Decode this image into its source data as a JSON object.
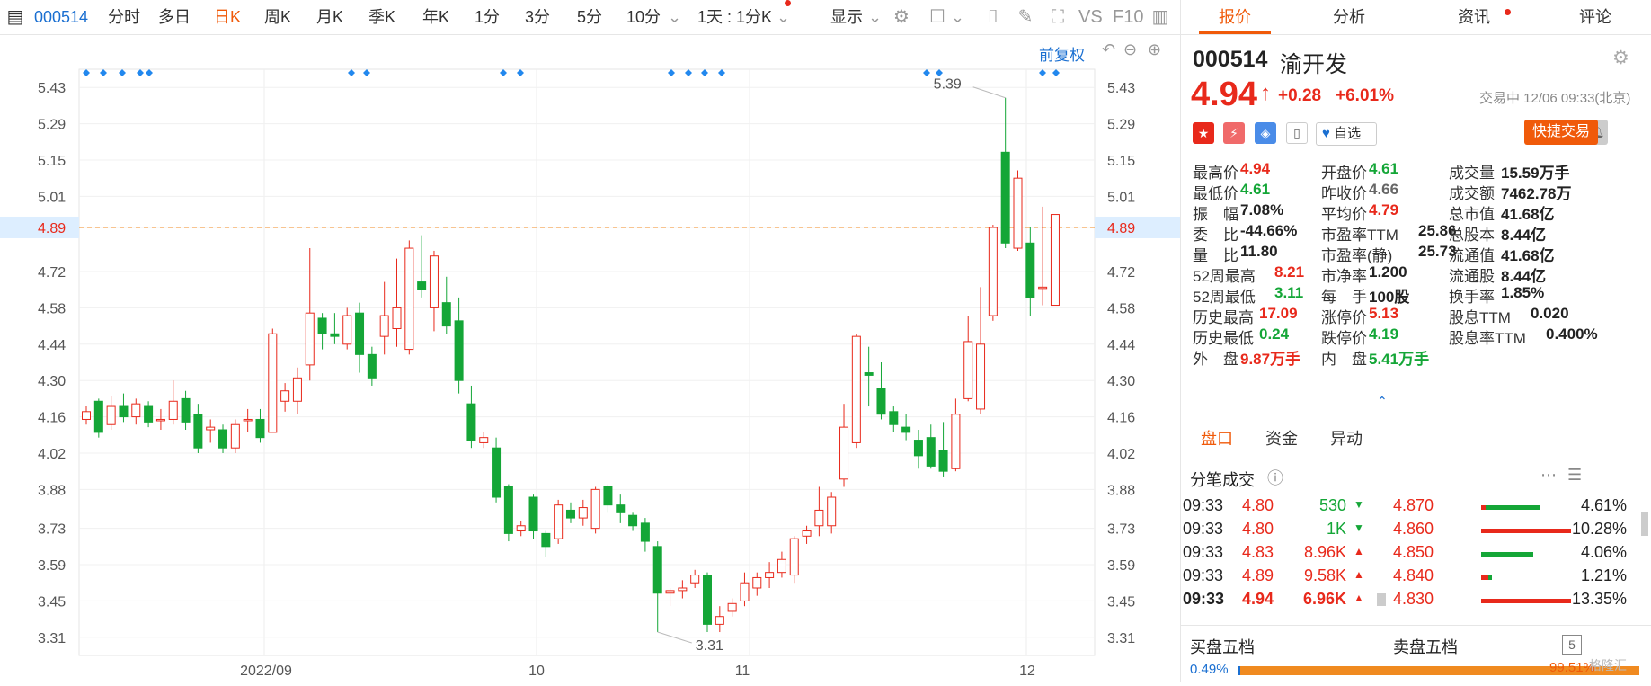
{
  "toolbar": {
    "code": "000514",
    "items": [
      "分时",
      "多日",
      "日K",
      "周K",
      "月K",
      "季K",
      "年K",
      "1分",
      "3分",
      "5分",
      "10分",
      "1天 : 1分K",
      "显示",
      "VS",
      "F10"
    ],
    "active": "日K",
    "restore_label": "前复权"
  },
  "chart": {
    "price_labels": [
      "5.43",
      "5.29",
      "5.15",
      "5.01",
      "4.89",
      "4.72",
      "4.58",
      "4.44",
      "4.30",
      "4.16",
      "4.02",
      "3.88",
      "3.73",
      "3.59",
      "3.45",
      "3.31"
    ],
    "current_price_label": "4.89",
    "date_labels": [
      "2022/09",
      "10",
      "11",
      "12"
    ],
    "high_annotation": "5.39",
    "low_annotation": "3.31"
  },
  "chart_data": {
    "type": "candlestick",
    "y_range": [
      3.24,
      5.5
    ],
    "x_labels": [
      "2022/09",
      "10",
      "11",
      "12"
    ],
    "current_price": 4.89,
    "max_label": "5.39",
    "min_label": "3.31",
    "candles": [
      [
        4.15,
        4.18,
        4.13,
        4.2
      ],
      [
        4.22,
        4.1,
        4.08,
        4.23
      ],
      [
        4.13,
        4.2,
        4.11,
        4.24
      ],
      [
        4.2,
        4.16,
        4.14,
        4.25
      ],
      [
        4.16,
        4.21,
        4.13,
        4.23
      ],
      [
        4.2,
        4.14,
        4.12,
        4.22
      ],
      [
        4.15,
        4.15,
        4.11,
        4.19
      ],
      [
        4.15,
        4.22,
        4.13,
        4.3
      ],
      [
        4.23,
        4.14,
        4.11,
        4.26
      ],
      [
        4.17,
        4.04,
        4.02,
        4.21
      ],
      [
        4.11,
        4.12,
        4.06,
        4.15
      ],
      [
        4.11,
        4.04,
        4.02,
        4.13
      ],
      [
        4.04,
        4.13,
        4.02,
        4.15
      ],
      [
        4.15,
        4.15,
        4.1,
        4.19
      ],
      [
        4.15,
        4.08,
        4.06,
        4.19
      ],
      [
        4.1,
        4.48,
        4.1,
        4.5
      ],
      [
        4.22,
        4.26,
        4.18,
        4.29
      ],
      [
        4.22,
        4.31,
        4.17,
        4.35
      ],
      [
        4.36,
        4.56,
        4.3,
        4.81
      ],
      [
        4.54,
        4.48,
        4.42,
        4.56
      ],
      [
        4.48,
        4.47,
        4.44,
        4.56
      ],
      [
        4.44,
        4.55,
        4.42,
        4.58
      ],
      [
        4.56,
        4.4,
        4.33,
        4.6
      ],
      [
        4.4,
        4.31,
        4.28,
        4.43
      ],
      [
        4.47,
        4.55,
        4.4,
        4.68
      ],
      [
        4.5,
        4.58,
        4.43,
        4.77
      ],
      [
        4.42,
        4.81,
        4.4,
        4.84
      ],
      [
        4.68,
        4.65,
        4.62,
        4.86
      ],
      [
        4.58,
        4.78,
        4.49,
        4.8
      ],
      [
        4.6,
        4.51,
        4.48,
        4.7
      ],
      [
        4.53,
        4.3,
        4.25,
        4.62
      ],
      [
        4.21,
        4.07,
        4.04,
        4.28
      ],
      [
        4.06,
        4.08,
        4.04,
        4.1
      ],
      [
        4.04,
        3.85,
        3.83,
        4.08
      ],
      [
        3.89,
        3.71,
        3.68,
        3.9
      ],
      [
        3.72,
        3.74,
        3.7,
        3.76
      ],
      [
        3.85,
        3.72,
        3.69,
        3.86
      ],
      [
        3.71,
        3.66,
        3.62,
        3.72
      ],
      [
        3.69,
        3.82,
        3.67,
        3.84
      ],
      [
        3.8,
        3.77,
        3.75,
        3.83
      ],
      [
        3.77,
        3.81,
        3.74,
        3.84
      ],
      [
        3.73,
        3.88,
        3.71,
        3.89
      ],
      [
        3.89,
        3.82,
        3.79,
        3.9
      ],
      [
        3.82,
        3.79,
        3.75,
        3.86
      ],
      [
        3.78,
        3.74,
        3.72,
        3.79
      ],
      [
        3.75,
        3.68,
        3.64,
        3.77
      ],
      [
        3.66,
        3.48,
        3.33,
        3.68
      ],
      [
        3.48,
        3.49,
        3.43,
        3.5
      ],
      [
        3.49,
        3.5,
        3.46,
        3.53
      ],
      [
        3.52,
        3.55,
        3.5,
        3.57
      ],
      [
        3.55,
        3.36,
        3.33,
        3.56
      ],
      [
        3.36,
        3.39,
        3.33,
        3.43
      ],
      [
        3.41,
        3.44,
        3.39,
        3.46
      ],
      [
        3.45,
        3.52,
        3.43,
        3.56
      ],
      [
        3.5,
        3.54,
        3.47,
        3.56
      ],
      [
        3.54,
        3.56,
        3.5,
        3.6
      ],
      [
        3.56,
        3.61,
        3.54,
        3.64
      ],
      [
        3.55,
        3.69,
        3.52,
        3.7
      ],
      [
        3.7,
        3.72,
        3.67,
        3.74
      ],
      [
        3.74,
        3.8,
        3.7,
        3.89
      ],
      [
        3.74,
        3.85,
        3.71,
        3.87
      ],
      [
        3.92,
        4.12,
        3.89,
        4.21
      ],
      [
        4.06,
        4.47,
        4.04,
        4.48
      ],
      [
        4.33,
        4.32,
        4.2,
        4.43
      ],
      [
        4.27,
        4.17,
        4.15,
        4.37
      ],
      [
        4.18,
        4.13,
        4.1,
        4.2
      ],
      [
        4.12,
        4.1,
        4.07,
        4.17
      ],
      [
        4.07,
        4.01,
        3.96,
        4.11
      ],
      [
        4.08,
        3.97,
        3.96,
        4.13
      ],
      [
        4.03,
        3.95,
        3.93,
        4.14
      ],
      [
        3.96,
        4.17,
        3.95,
        4.23
      ],
      [
        4.23,
        4.45,
        4.22,
        4.55
      ],
      [
        4.19,
        4.44,
        4.17,
        4.66
      ],
      [
        4.55,
        4.89,
        4.53,
        4.9
      ],
      [
        5.18,
        4.83,
        4.81,
        5.39
      ],
      [
        4.81,
        5.08,
        4.8,
        5.11
      ],
      [
        4.83,
        4.62,
        4.55,
        4.89
      ],
      [
        4.66,
        4.66,
        4.59,
        4.97
      ],
      [
        4.59,
        4.94,
        4.59,
        4.94
      ]
    ]
  },
  "quote": {
    "code": "000514",
    "name": "渝开发",
    "price": "4.94",
    "change": "+0.28",
    "change_pct": "+6.01%",
    "status_time": "交易中 12/06 09:33(北京)",
    "watch_label": "自选",
    "trade_button": "快捷交易"
  },
  "tabs": [
    "报价",
    "分析",
    "资讯",
    "评论"
  ],
  "stats": [
    [
      {
        "label": "最高价",
        "value": "4.94",
        "color": "red"
      },
      {
        "label": "开盘价",
        "value": "4.61",
        "color": "green"
      },
      {
        "label": "成交量",
        "value": "15.59万手",
        "color": "black"
      }
    ],
    [
      {
        "label": "最低价",
        "value": "4.61",
        "color": "green"
      },
      {
        "label": "昨收价",
        "value": "4.66",
        "color": "gray"
      },
      {
        "label": "成交额",
        "value": "7462.78万",
        "color": "black"
      }
    ],
    [
      {
        "label": "振　幅",
        "value": "7.08%",
        "color": "black"
      },
      {
        "label": "平均价",
        "value": "4.79",
        "color": "red"
      },
      {
        "label": "总市值",
        "value": "41.68亿",
        "color": "black"
      }
    ],
    [
      {
        "label": "委　比",
        "value": "-44.66%",
        "color": "black"
      },
      {
        "label": "市盈率TTM",
        "value": "25.86",
        "color": "black"
      },
      {
        "label": "总股本",
        "value": "8.44亿",
        "color": "black"
      }
    ],
    [
      {
        "label": "量　比",
        "value": "11.80",
        "color": "black"
      },
      {
        "label": "市盈率(静)",
        "value": "25.73",
        "color": "black"
      },
      {
        "label": "流通值",
        "value": "41.68亿",
        "color": "black"
      }
    ],
    [
      {
        "label": "52周最高",
        "value": "8.21",
        "color": "red"
      },
      {
        "label": "市净率",
        "value": "1.200",
        "color": "black"
      },
      {
        "label": "流通股",
        "value": "8.44亿",
        "color": "black"
      }
    ],
    [
      {
        "label": "52周最低",
        "value": "3.11",
        "color": "green"
      },
      {
        "label": "每　手",
        "value": "100股",
        "color": "black"
      },
      {
        "label": "换手率",
        "value": "1.85%",
        "color": "black"
      }
    ],
    [
      {
        "label": "历史最高",
        "value": "17.09",
        "color": "red"
      },
      {
        "label": "涨停价",
        "value": "5.13",
        "color": "red"
      },
      {
        "label": "股息TTM",
        "value": "0.020",
        "color": "black"
      }
    ],
    [
      {
        "label": "历史最低",
        "value": "0.24",
        "color": "green"
      },
      {
        "label": "跌停价",
        "value": "4.19",
        "color": "green"
      },
      {
        "label": "股息率TTM",
        "value": "0.400%",
        "color": "black"
      }
    ],
    [
      {
        "label": "外　盘",
        "value": "9.87万手",
        "color": "red"
      },
      {
        "label": "内　盘",
        "value": "5.41万手",
        "color": "green"
      }
    ]
  ],
  "sub_tabs": [
    "盘口",
    "资金",
    "异动"
  ],
  "ticks_title": "分笔成交",
  "ticks": [
    {
      "time": "09:33",
      "price": "4.80",
      "vol": "530",
      "dir": "down"
    },
    {
      "time": "09:33",
      "price": "4.80",
      "vol": "1K",
      "dir": "down"
    },
    {
      "time": "09:33",
      "price": "4.83",
      "vol": "8.96K",
      "dir": "up"
    },
    {
      "time": "09:33",
      "price": "4.89",
      "vol": "9.58K",
      "dir": "up"
    },
    {
      "time": "09:33",
      "price": "4.94",
      "vol": "6.96K",
      "dir": "up"
    }
  ],
  "distribution": [
    {
      "price": "4.870",
      "pct": "4.61%",
      "red": 0.05,
      "green": 0.6
    },
    {
      "price": "4.860",
      "pct": "10.28%",
      "red": 1.0,
      "green": 0.0
    },
    {
      "price": "4.850",
      "pct": "4.06%",
      "red": 0.0,
      "green": 0.58
    },
    {
      "price": "4.840",
      "pct": "1.21%",
      "red": 0.08,
      "green": 0.04
    },
    {
      "price": "4.830",
      "pct": "13.35%",
      "red": 1.0,
      "green": 0.0
    }
  ],
  "order_book": {
    "buy_title": "买盘五档",
    "sell_title": "卖盘五档",
    "buy_pct": "0.49%",
    "sell_pct": "99.51%",
    "buy_fraction": 0.0049
  },
  "watermark": "格隆汇"
}
